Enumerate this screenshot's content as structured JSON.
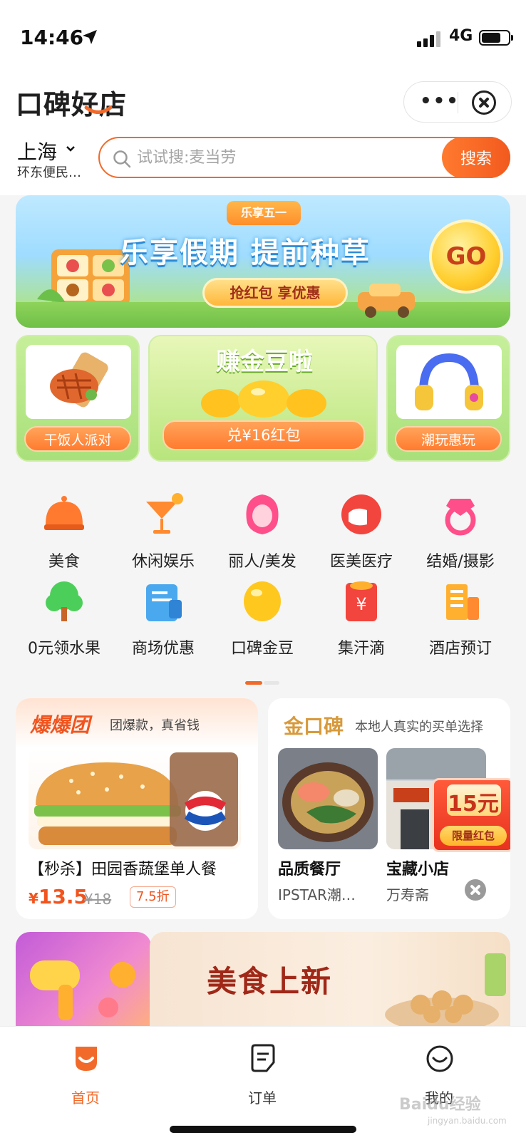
{
  "status_bar": {
    "time": "14:46",
    "network": "4G"
  },
  "header": {
    "logo_text": "口碑好店",
    "city": "上海",
    "district": "环东便民…",
    "search": {
      "placeholder": "试试搜:麦当劳",
      "button_label": "搜索"
    }
  },
  "banner": {
    "tag": "乐享五一",
    "title": "乐享假期 提前种草",
    "pill": "抢红包 享优惠",
    "go": "GO"
  },
  "promos": {
    "left_button": "干饭人派对",
    "mid_title": "赚金豆啦",
    "mid_button": "兑¥16红包",
    "right_button": "潮玩惠玩"
  },
  "categories": [
    {
      "label": "美食",
      "icon": "food-cover-icon"
    },
    {
      "label": "休闲娱乐",
      "icon": "cocktail-icon"
    },
    {
      "label": "丽人/美发",
      "icon": "hair-woman-icon"
    },
    {
      "label": "医美医疗",
      "icon": "medical-mask-icon"
    },
    {
      "label": "结婚/摄影",
      "icon": "ring-icon"
    },
    {
      "label": "0元领水果",
      "icon": "tree-icon"
    },
    {
      "label": "商场优惠",
      "icon": "coupon-icon"
    },
    {
      "label": "口碑金豆",
      "icon": "gold-bean-icon"
    },
    {
      "label": "集汗滴",
      "icon": "red-envelope-icon"
    },
    {
      "label": "酒店预订",
      "icon": "hotel-icon"
    }
  ],
  "baobao": {
    "logo": "爆爆团",
    "subtitle": "团爆款，真省钱",
    "deal_title": "【秒杀】田园香蔬堡单人餐",
    "price": "13.5",
    "currency": "¥",
    "original_price": "¥18",
    "discount": "7.5折"
  },
  "jinkoubei": {
    "logo": "金口碑",
    "subtitle": "本地人真实的买单选择",
    "shops": [
      {
        "name": "品质餐厅",
        "sub": "IPSTAR潮…"
      },
      {
        "name": "宝藏小店",
        "sub": "万寿斋"
      }
    ],
    "red_packet": {
      "amount": "15元",
      "label": "限量红包"
    }
  },
  "bottom_banner": {
    "title": "美食上新"
  },
  "tabbar": [
    {
      "label": "首页",
      "icon": "home-icon",
      "active": true
    },
    {
      "label": "订单",
      "icon": "order-icon",
      "active": false
    },
    {
      "label": "我的",
      "icon": "profile-icon",
      "active": false
    }
  ],
  "watermark": {
    "text": "Baidu经验",
    "sub": "jingyan.baidu.com"
  },
  "colors": {
    "accent": "#f26a2a",
    "brand_red": "#f1541e",
    "banner_green": "#8fd35b"
  }
}
